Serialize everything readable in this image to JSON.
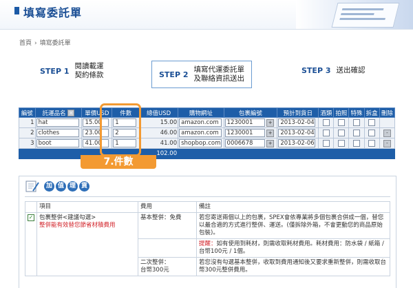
{
  "header": {
    "title": "填寫委託單"
  },
  "breadcrumb": [
    "首頁",
    "›",
    "填寫委託單"
  ],
  "steps": [
    {
      "num": "STEP 1",
      "line1": "閱讀載運",
      "line2": "契約條款"
    },
    {
      "num": "STEP 2",
      "line1": "填寫代運委託單",
      "line2": "及聯絡資訊送出"
    },
    {
      "num": "STEP 3",
      "line1": "送出確認",
      "line2": ""
    }
  ],
  "order_table": {
    "headers": [
      "編號",
      "託運品名",
      "單價USD",
      "件數",
      "總值USD",
      "購物網址",
      "包裹編號",
      "預計到貨日",
      "酒類",
      "拍照",
      "特殊",
      "拆盒",
      "刪除"
    ],
    "header_icon": "x-icon",
    "rows": [
      {
        "no": "1",
        "name": "hat",
        "price": "15.00",
        "qty": "1",
        "total": "15.00",
        "url": "amazon.com",
        "pkg": "1230001",
        "date": "2013-02-04"
      },
      {
        "no": "2",
        "name": "clothes",
        "price": "23.00",
        "qty": "2",
        "total": "46.00",
        "url": "amazon.com",
        "pkg": "1230001",
        "date": "2013-02-04"
      },
      {
        "no": "3",
        "name": "boot",
        "price": "41.00",
        "qty": "1",
        "total": "41.00",
        "url": "shopbop.com",
        "pkg": "0006678",
        "date": "2013-02-06"
      }
    ],
    "grand_total": "102.00",
    "delete_symbol": "-",
    "picker_symbol": "+"
  },
  "callout": {
    "label": "7.件數",
    "color": "#f39a32"
  },
  "services": {
    "heading_chars": [
      "加",
      "值",
      "理",
      "貨"
    ],
    "col_item": "項目",
    "col_fee": "費用",
    "col_note": "備註",
    "item_title": "包裹整併<建議勾選>",
    "item_sub": "整併能有效替您節省材積費用",
    "r1_fee": "基本整併：免費",
    "r1_note": "若您寄送兩個以上的包裹，SPEX會依專業將多個包裹合併成一個，替您以最合適的方式進行整併、運送。(僅拆除外箱，不會更動您的商品原始包裝)。",
    "r2_note_prefix": "提醒：",
    "r2_note": "如有使用到耗材，則需收取耗材費用。耗材費用：防水袋 / 紙箱 / 台幣100元 / 1個。",
    "r3_fee_1": "二次整併：",
    "r3_fee_2": "台幣300元",
    "r3_note": "若您沒有勾選基本整併，收取到費用通知後又要求重新整併，則需收取台幣300元整併費用。"
  },
  "colors": {
    "brand": "#1b4f95",
    "table_header": "#1e5ea8",
    "accent": "#f39a32",
    "alert": "#d2232a"
  }
}
